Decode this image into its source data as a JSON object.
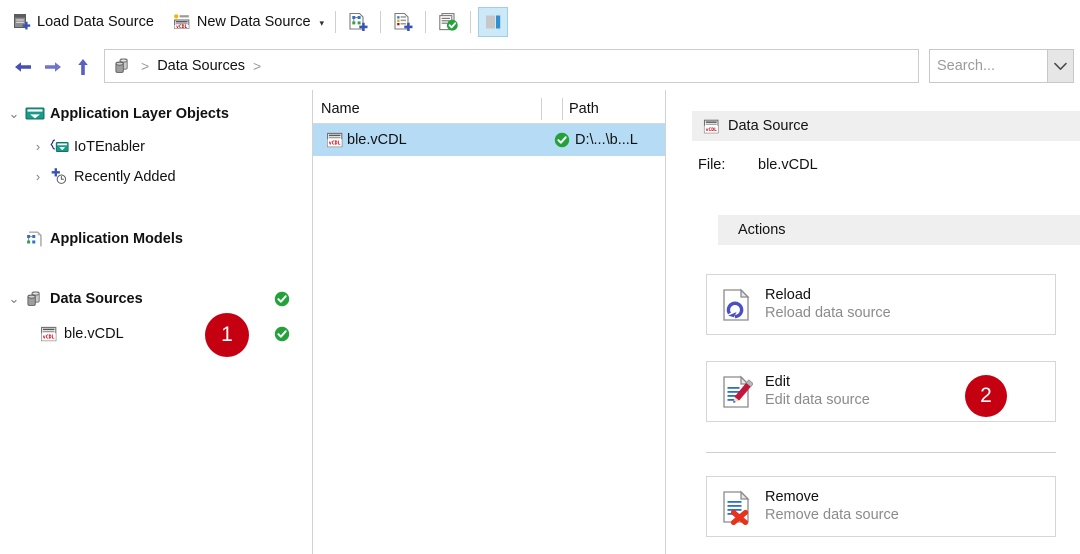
{
  "toolbar": {
    "load_label": "Load Data Source",
    "new_label": "New Data Source",
    "dropdown_caret": "▾",
    "icons": [
      {
        "name": "add-application-layer-object-icon"
      },
      {
        "name": "add-data-source-icon"
      },
      {
        "name": "validate-icon"
      },
      {
        "name": "toggle-detail-pane-icon"
      }
    ]
  },
  "nav": {
    "back": "←",
    "forward": "→",
    "up": "↑",
    "breadcrumb": {
      "root_icon": "data-sources-icon",
      "sep1": ">",
      "crumb": "Data Sources",
      "sep2": ">"
    },
    "search": {
      "placeholder": "Search...",
      "dropdown_caret": "⌄"
    }
  },
  "tree": {
    "items": [
      {
        "label": "Application Layer Objects",
        "twisty": "⌄",
        "icon": "application-layer-objects-icon",
        "bold": true,
        "indent": 0,
        "status": "",
        "selected": false
      },
      {
        "label": "IoTEnabler",
        "twisty": "›",
        "icon": "iot-enabler-icon",
        "bold": false,
        "indent": 1,
        "status": "",
        "selected": false
      },
      {
        "label": "Recently Added",
        "twisty": "›",
        "icon": "recently-added-icon",
        "bold": false,
        "indent": 1,
        "status": "",
        "selected": false
      },
      {
        "label": "Application Models",
        "twisty": "",
        "icon": "application-models-icon",
        "bold": true,
        "indent": 0,
        "status": "",
        "selected": false
      },
      {
        "label": "Data Sources",
        "twisty": "⌄",
        "icon": "data-sources-icon",
        "bold": true,
        "indent": 0,
        "status": "ok",
        "selected": true
      },
      {
        "label": "ble.vCDL",
        "twisty": "",
        "icon": "vcdl-file-icon",
        "bold": false,
        "indent": 1,
        "status": "ok",
        "selected": false
      }
    ]
  },
  "list": {
    "columns": [
      "Name",
      "",
      "Path"
    ],
    "rows": [
      {
        "icon": "vcdl-file-icon",
        "name": "ble.vCDL",
        "status": "ok",
        "path": "D:\\...\\b...L",
        "selected": true
      }
    ]
  },
  "detail": {
    "header_title": "Data Source",
    "header_icon": "vcdl-file-icon",
    "file_key": "File:",
    "file_value": "ble.vCDL",
    "actions_label": "Actions",
    "actions": [
      {
        "title": "Reload",
        "subtitle": "Reload data source",
        "icon": "reload-document-icon"
      },
      {
        "title": "Edit",
        "subtitle": "Edit data source",
        "icon": "edit-document-icon"
      },
      {
        "title": "Remove",
        "subtitle": "Remove data source",
        "icon": "remove-document-icon"
      }
    ]
  },
  "annotations": {
    "badges": [
      {
        "label": "1",
        "color": "#c40011"
      },
      {
        "label": "2",
        "color": "#c40011"
      }
    ]
  }
}
